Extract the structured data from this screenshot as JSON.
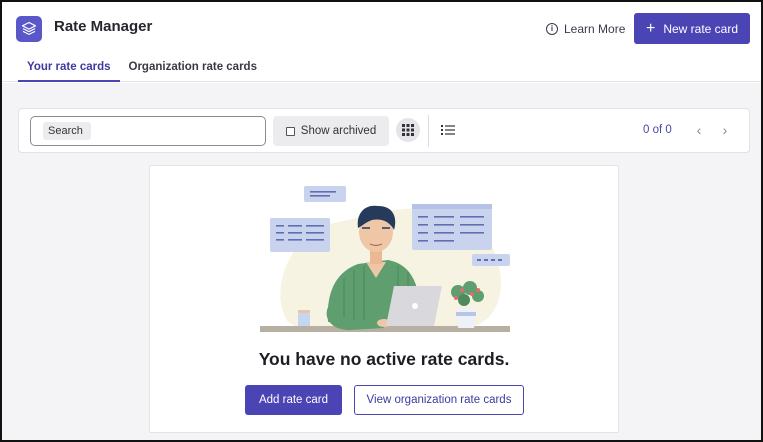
{
  "app": {
    "title": "Rate Manager",
    "logo_icon": "layers-stack-icon"
  },
  "header": {
    "learn_more_label": "Learn More",
    "learn_more_icon": "info-icon",
    "new_button_label": "New rate card",
    "new_button_icon": "plus-icon"
  },
  "tabs": [
    {
      "label": "Your rate cards",
      "active": true
    },
    {
      "label": "Organization rate cards",
      "active": false
    }
  ],
  "toolbar": {
    "search_placeholder": "Search",
    "show_archived_label": "Show archived",
    "show_archived_checked": false,
    "grid_view_icon": "grid-view-icon",
    "list_view_icon": "list-view-icon",
    "count_label": "0 of 0",
    "prev_icon": "chevron-left-icon",
    "next_icon": "chevron-right-icon"
  },
  "empty_state": {
    "illustration": "person-working-on-laptop-illustration",
    "title": "You have no active rate cards.",
    "primary_button": "Add rate card",
    "secondary_button": "View organization rate cards"
  },
  "colors": {
    "accent": "#4b44b5",
    "accent_text": "#3e3aa0",
    "page_background": "#f4f4f7",
    "border": "#e3e3e8"
  }
}
